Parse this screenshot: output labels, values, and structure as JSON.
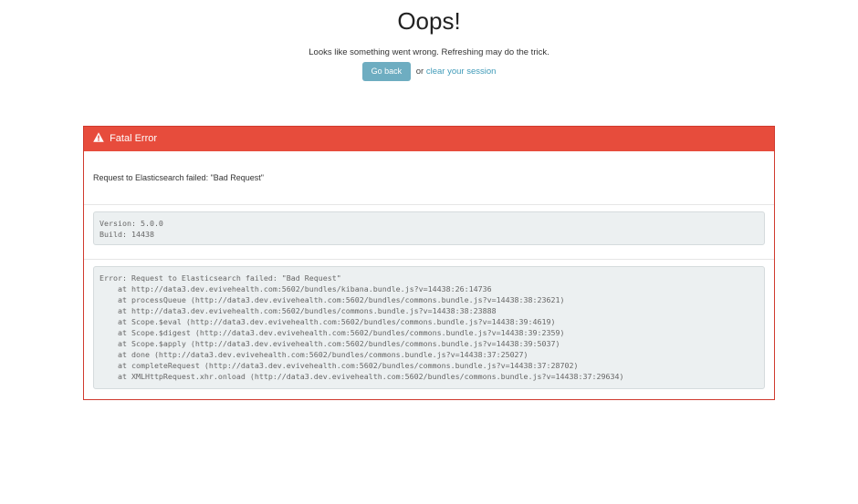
{
  "header": {
    "title": "Oops!",
    "subtitle": "Looks like something went wrong. Refreshing may do the trick.",
    "go_back_label": "Go back",
    "or_text": "or",
    "clear_session_label": "clear your session"
  },
  "panel": {
    "heading_icon": "warning-icon",
    "heading": "Fatal Error",
    "message": "Request to Elasticsearch failed: \"Bad Request\"",
    "version_info": "Version: 5.0.0\nBuild: 14438",
    "stack_trace": "Error: Request to Elasticsearch failed: \"Bad Request\"\n    at http://data3.dev.evivehealth.com:5602/bundles/kibana.bundle.js?v=14438:26:14736\n    at processQueue (http://data3.dev.evivehealth.com:5602/bundles/commons.bundle.js?v=14438:38:23621)\n    at http://data3.dev.evivehealth.com:5602/bundles/commons.bundle.js?v=14438:38:23888\n    at Scope.$eval (http://data3.dev.evivehealth.com:5602/bundles/commons.bundle.js?v=14438:39:4619)\n    at Scope.$digest (http://data3.dev.evivehealth.com:5602/bundles/commons.bundle.js?v=14438:39:2359)\n    at Scope.$apply (http://data3.dev.evivehealth.com:5602/bundles/commons.bundle.js?v=14438:39:5037)\n    at done (http://data3.dev.evivehealth.com:5602/bundles/commons.bundle.js?v=14438:37:25027)\n    at completeRequest (http://data3.dev.evivehealth.com:5602/bundles/commons.bundle.js?v=14438:37:28702)\n    at XMLHttpRequest.xhr.onload (http://data3.dev.evivehealth.com:5602/bundles/commons.bundle.js?v=14438:37:29634)"
  },
  "colors": {
    "danger": "#e74c3c",
    "button": "#6eadc1",
    "link": "#3f9ab8",
    "code_bg": "#ecf0f1"
  }
}
